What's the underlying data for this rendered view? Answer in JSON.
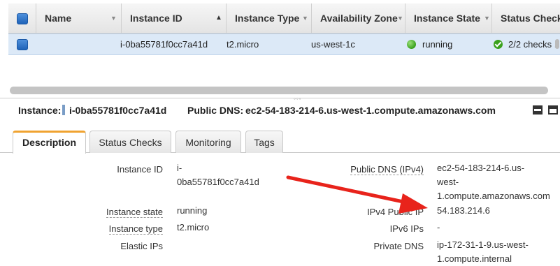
{
  "table": {
    "columns": [
      {
        "label": "Name"
      },
      {
        "label": "Instance ID"
      },
      {
        "label": "Instance Type"
      },
      {
        "label": "Availability Zone"
      },
      {
        "label": "Instance State"
      },
      {
        "label": "Status Checks"
      }
    ],
    "rows": [
      {
        "name": "",
        "instance_id": "i-0ba55781f0cc7a41d",
        "instance_type": "t2.micro",
        "availability_zone": "us-west-1c",
        "instance_state": "running",
        "status_checks": "2/2 checks ..."
      }
    ]
  },
  "detail": {
    "instance_label": "Instance:",
    "instance_id": "i-0ba55781f0cc7a41d",
    "public_dns_label": "Public DNS:",
    "public_dns": "ec2-54-183-214-6.us-west-1.compute.amazonaws.com"
  },
  "tabs": [
    {
      "label": "Description",
      "active": true
    },
    {
      "label": "Status Checks",
      "active": false
    },
    {
      "label": "Monitoring",
      "active": false
    },
    {
      "label": "Tags",
      "active": false
    }
  ],
  "description": {
    "left": [
      {
        "label": "Instance ID",
        "value_lines": [
          "i-",
          "0ba55781f0cc7a41d"
        ]
      },
      {
        "label": "Instance state",
        "value_lines": [
          "running"
        ]
      },
      {
        "label": "Instance type",
        "value_lines": [
          "t2.micro"
        ]
      },
      {
        "label": "Elastic IPs",
        "value_lines": [
          ""
        ]
      }
    ],
    "right": [
      {
        "label": "Public DNS (IPv4)",
        "value_lines": [
          "ec2-54-183-214-6.us-",
          "west-",
          "1.compute.amazonaws.com"
        ]
      },
      {
        "label": "IPv4 Public IP",
        "value_lines": [
          "54.183.214.6"
        ]
      },
      {
        "label": "IPv6 IPs",
        "value_lines": [
          "-"
        ]
      },
      {
        "label": "Private DNS",
        "value_lines": [
          "ip-172-31-1-9.us-west-",
          "1.compute.internal"
        ]
      }
    ]
  },
  "colors": {
    "accent_tab": "#f0a330",
    "running": "#3aa11d",
    "selection": "#dce9f7",
    "annotation_arrow": "#e8231b"
  },
  "icons": [
    "checkbox-icon",
    "sort-desc-icon",
    "sort-asc-icon",
    "running-status-icon",
    "checks-passed-icon",
    "minimize-panel-icon",
    "maximize-panel-icon"
  ]
}
